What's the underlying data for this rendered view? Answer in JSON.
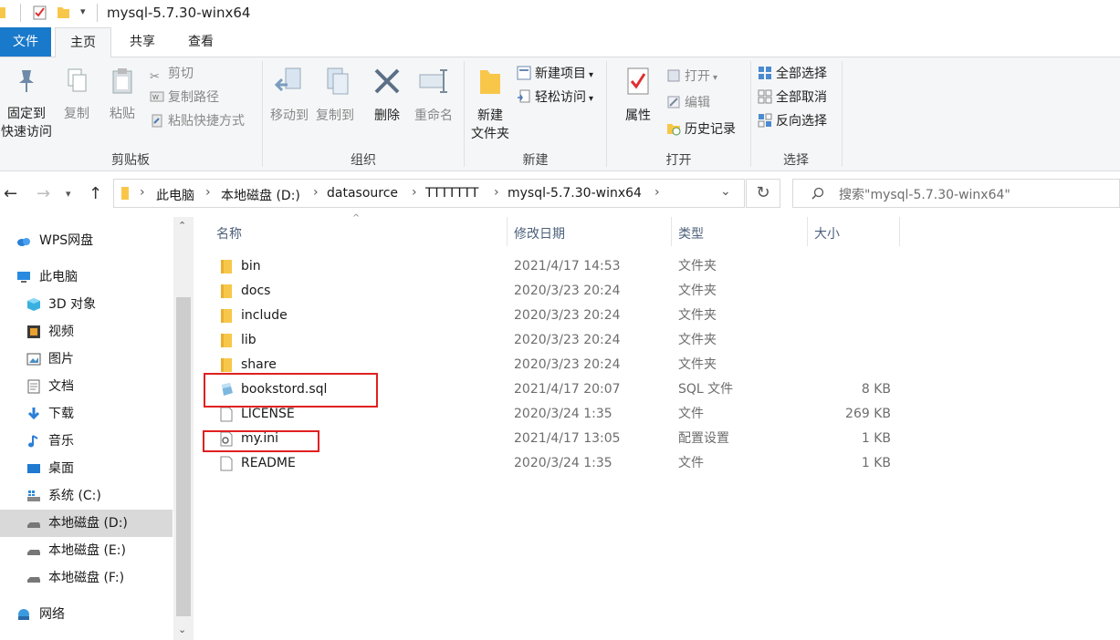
{
  "window": {
    "title": "mysql-5.7.30-winx64"
  },
  "ribbon_tabs": [
    {
      "label": "文件"
    },
    {
      "label": "主页"
    },
    {
      "label": "共享"
    },
    {
      "label": "查看"
    }
  ],
  "ribbon": {
    "clipboard": {
      "label": "剪贴板",
      "pin": "固定到",
      "pin2": "快速访问",
      "copy": "复制",
      "paste": "粘贴",
      "cut": "剪切",
      "copy_path": "复制路径",
      "paste_shortcut": "粘贴快捷方式"
    },
    "organize": {
      "label": "组织",
      "move_to": "移动到",
      "copy_to": "复制到",
      "delete": "删除",
      "rename": "重命名"
    },
    "new": {
      "label": "新建",
      "new_folder_1": "新建",
      "new_folder_2": "文件夹",
      "new_item": "新建项目",
      "easy_access": "轻松访问"
    },
    "open": {
      "label": "打开",
      "properties": "属性",
      "open": "打开",
      "edit": "编辑",
      "history": "历史记录"
    },
    "select": {
      "label": "选择",
      "select_all": "全部选择",
      "select_none": "全部取消",
      "invert": "反向选择"
    }
  },
  "address": {
    "crumbs": [
      "此电脑",
      "本地磁盘 (D:)",
      "datasource",
      "TTTTTTT",
      "mysql-5.7.30-winx64"
    ],
    "search_placeholder": "搜索\"mysql-5.7.30-winx64\""
  },
  "nav_pane": {
    "items": [
      {
        "label": "WPS网盘",
        "icon": "cloud-icon"
      },
      {
        "label": "此电脑",
        "icon": "computer-icon"
      },
      {
        "label": "3D 对象",
        "icon": "cube-icon"
      },
      {
        "label": "视频",
        "icon": "video-icon"
      },
      {
        "label": "图片",
        "icon": "picture-icon"
      },
      {
        "label": "文档",
        "icon": "document-icon"
      },
      {
        "label": "下载",
        "icon": "download-icon"
      },
      {
        "label": "音乐",
        "icon": "music-icon"
      },
      {
        "label": "桌面",
        "icon": "desktop-icon"
      },
      {
        "label": "系统 (C:)",
        "icon": "system-drive-icon"
      },
      {
        "label": "本地磁盘 (D:)",
        "icon": "drive-icon"
      },
      {
        "label": "本地磁盘 (E:)",
        "icon": "drive-icon"
      },
      {
        "label": "本地磁盘 (F:)",
        "icon": "drive-icon"
      },
      {
        "label": "网络",
        "icon": "network-icon"
      }
    ]
  },
  "file_list": {
    "columns": [
      "名称",
      "修改日期",
      "类型",
      "大小"
    ],
    "rows": [
      {
        "name": "bin",
        "date": "2021/4/17 14:53",
        "type": "文件夹",
        "size": "",
        "icon": "folder-icon"
      },
      {
        "name": "docs",
        "date": "2020/3/23 20:24",
        "type": "文件夹",
        "size": "",
        "icon": "folder-icon"
      },
      {
        "name": "include",
        "date": "2020/3/23 20:24",
        "type": "文件夹",
        "size": "",
        "icon": "folder-icon"
      },
      {
        "name": "lib",
        "date": "2020/3/23 20:24",
        "type": "文件夹",
        "size": "",
        "icon": "folder-icon"
      },
      {
        "name": "share",
        "date": "2020/3/23 20:24",
        "type": "文件夹",
        "size": "",
        "icon": "folder-icon"
      },
      {
        "name": "bookstord.sql",
        "date": "2021/4/17 20:07",
        "type": "SQL 文件",
        "size": "8 KB",
        "icon": "sql-file-icon"
      },
      {
        "name": "LICENSE",
        "date": "2020/3/24 1:35",
        "type": "文件",
        "size": "269 KB",
        "icon": "file-icon"
      },
      {
        "name": "my.ini",
        "date": "2021/4/17 13:05",
        "type": "配置设置",
        "size": "1 KB",
        "icon": "config-file-icon"
      },
      {
        "name": "README",
        "date": "2020/3/24 1:35",
        "type": "文件",
        "size": "1 KB",
        "icon": "file-icon"
      }
    ]
  },
  "colors": {
    "accent": "#1979ca",
    "highlight_box": "#e02020",
    "folder": "#f8c74a"
  }
}
